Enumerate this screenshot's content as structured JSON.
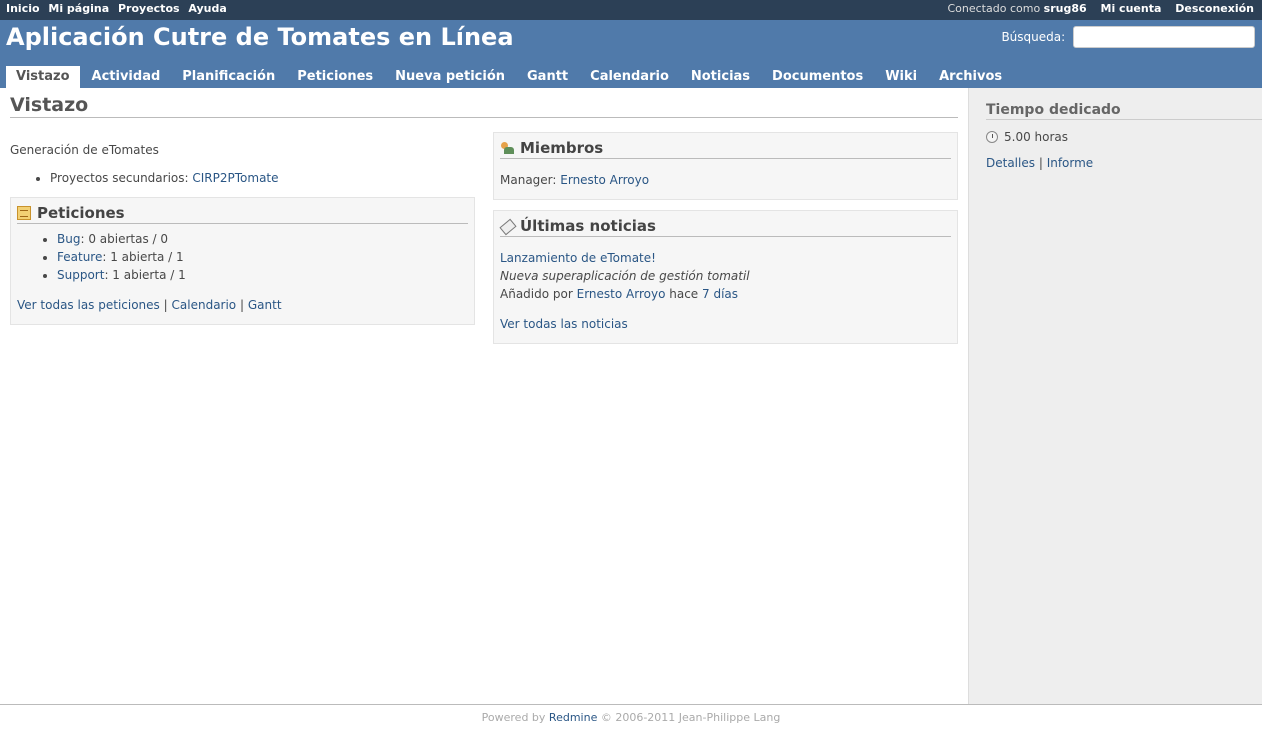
{
  "top_menu": {
    "home": "Inicio",
    "my_page": "Mi página",
    "projects": "Proyectos",
    "help": "Ayuda",
    "logged_as_prefix": "Conectado como",
    "username": "srug86",
    "my_account": "Mi cuenta",
    "logout": "Desconexión"
  },
  "header": {
    "title": "Aplicación Cutre de Tomates en Línea",
    "search_label": "Búsqueda:",
    "search_value": ""
  },
  "main_menu": {
    "overview": "Vistazo",
    "activity": "Actividad",
    "roadmap": "Planificación",
    "issues": "Peticiones",
    "new_issue": "Nueva petición",
    "gantt": "Gantt",
    "calendar": "Calendario",
    "news": "Noticias",
    "documents": "Documentos",
    "wiki": "Wiki",
    "files": "Archivos"
  },
  "content": {
    "title": "Vistazo",
    "description": "Generación de eTomates",
    "subprojects_label": "Proyectos secundarios:",
    "subproject": "CIRP2PTomate",
    "issues_box": {
      "title": "Peticiones",
      "trackers": [
        {
          "name": "Bug",
          "stats": ": 0 abiertas / 0"
        },
        {
          "name": "Feature",
          "stats": ": 1 abierta / 1"
        },
        {
          "name": "Support",
          "stats": ": 1 abierta / 1"
        }
      ],
      "view_all": "Ver todas las peticiones",
      "calendar": "Calendario",
      "gantt": "Gantt",
      "separator": "|"
    },
    "members_box": {
      "title": "Miembros",
      "role": "Manager:",
      "member": "Ernesto Arroyo"
    },
    "news_box": {
      "title": "Últimas noticias",
      "news_title": "Lanzamiento de eTomate!",
      "news_summary": "Nueva superaplicación de gestión tomatil",
      "added_by": "Añadido por",
      "author": "Ernesto Arroyo",
      "ago_prefix": "hace",
      "ago": "7 días",
      "view_all": "Ver todas las noticias"
    }
  },
  "sidebar": {
    "title": "Tiempo dedicado",
    "hours": "5.00 horas",
    "details": "Detalles",
    "separator": "|",
    "report": "Informe"
  },
  "footer": {
    "powered_by": "Powered by",
    "redmine": "Redmine",
    "copyright": "© 2006-2011 Jean-Philippe Lang"
  }
}
